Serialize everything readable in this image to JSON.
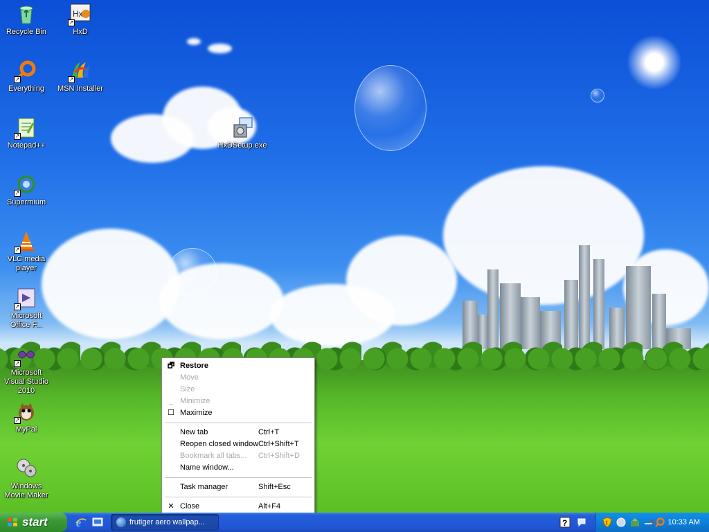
{
  "desktop": {
    "icons": [
      {
        "label": "Recycle Bin",
        "icon": "recycle-bin-icon"
      },
      {
        "label": "HxD",
        "icon": "hxd-icon"
      },
      {
        "label": "Everything",
        "icon": "everything-icon"
      },
      {
        "label": "MSN Installer",
        "icon": "msn-icon"
      },
      {
        "label": "Notepad++",
        "icon": "notepad-plus-plus-icon"
      },
      {
        "label": "HxDSetup.exe",
        "icon": "installer-icon"
      },
      {
        "label": "Supermium",
        "icon": "supermium-icon"
      },
      {
        "label": "VLC media player",
        "icon": "vlc-icon"
      },
      {
        "label": "Microsoft Office F...",
        "icon": "office-icon"
      },
      {
        "label": "Microsoft Visual Studio 2010",
        "icon": "visual-studio-icon"
      },
      {
        "label": "MyPal",
        "icon": "mypal-icon"
      },
      {
        "label": "Windows Movie Maker",
        "icon": "movie-maker-icon"
      }
    ]
  },
  "context_menu": {
    "items": [
      {
        "label": "Restore",
        "shortcut": "",
        "glyph": "restore-icon"
      },
      {
        "label": "Move",
        "shortcut": ""
      },
      {
        "label": "Size",
        "shortcut": ""
      },
      {
        "label": "Minimize",
        "shortcut": "",
        "glyph": "minimize-icon"
      },
      {
        "label": "Maximize",
        "shortcut": "",
        "glyph": "maximize-icon"
      },
      {
        "label": "New tab",
        "shortcut": "Ctrl+T"
      },
      {
        "label": "Reopen closed window",
        "shortcut": "Ctrl+Shift+T"
      },
      {
        "label": "Bookmark all tabs...",
        "shortcut": "Ctrl+Shift+D"
      },
      {
        "label": "Name window...",
        "shortcut": ""
      },
      {
        "label": "Task manager",
        "shortcut": "Shift+Esc"
      },
      {
        "label": "Close",
        "shortcut": "Alt+F4",
        "glyph": "close-icon"
      }
    ]
  },
  "taskbar": {
    "start_label": "start",
    "task_button_label": "frutiger aero wallpap...",
    "clock": "10:33 AM"
  },
  "colors": {
    "taskbar_blue": "#245edb",
    "start_green": "#3a9a34",
    "tray_blue": "#0d80d8"
  }
}
